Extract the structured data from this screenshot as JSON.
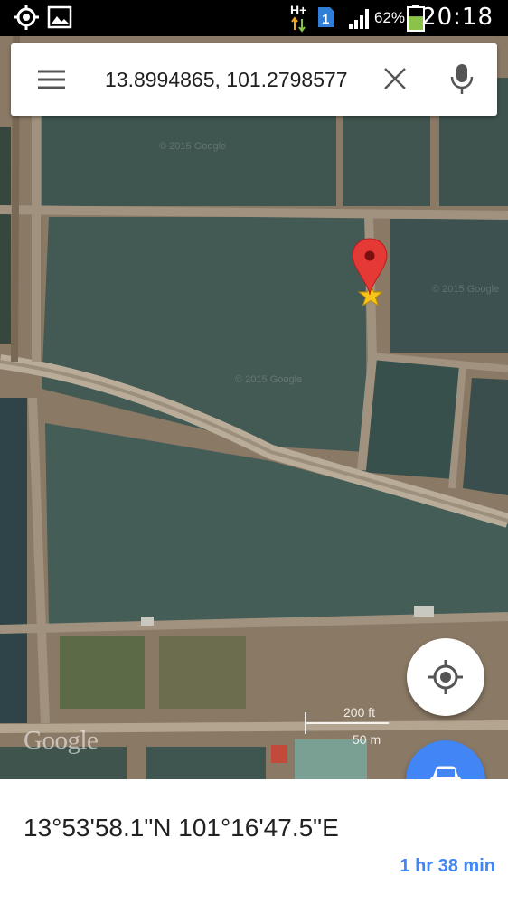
{
  "status_bar": {
    "icons": [
      "gps-icon",
      "image-icon",
      "data-hplus-icon",
      "sim1-icon",
      "signal-icon",
      "battery-icon"
    ],
    "network": "H+",
    "sim": "1",
    "battery_percent": "62%",
    "battery_level": 0.62,
    "time": "20:18"
  },
  "search": {
    "value": "13.8994865, 101.2798577",
    "menu_icon": "menu-icon",
    "clear_icon": "close-icon",
    "mic_icon": "mic-icon"
  },
  "map": {
    "watermark": "© 2015 Google",
    "attribution": "Google",
    "scale_imperial": "200 ft",
    "scale_metric": "50 m",
    "marker_icon": "red-map-pin-icon",
    "star_icon": "star-icon"
  },
  "buttons": {
    "my_location_icon": "my-location-icon",
    "directions_icon": "car-icon"
  },
  "place": {
    "coordinates": "13°53'58.1\"N 101°16'47.5\"E",
    "travel_time": "1 hr 38 min"
  },
  "colors": {
    "accent": "#4285f4",
    "pin": "#e53935",
    "water": "#3f5550",
    "land": "#8c7a66"
  }
}
